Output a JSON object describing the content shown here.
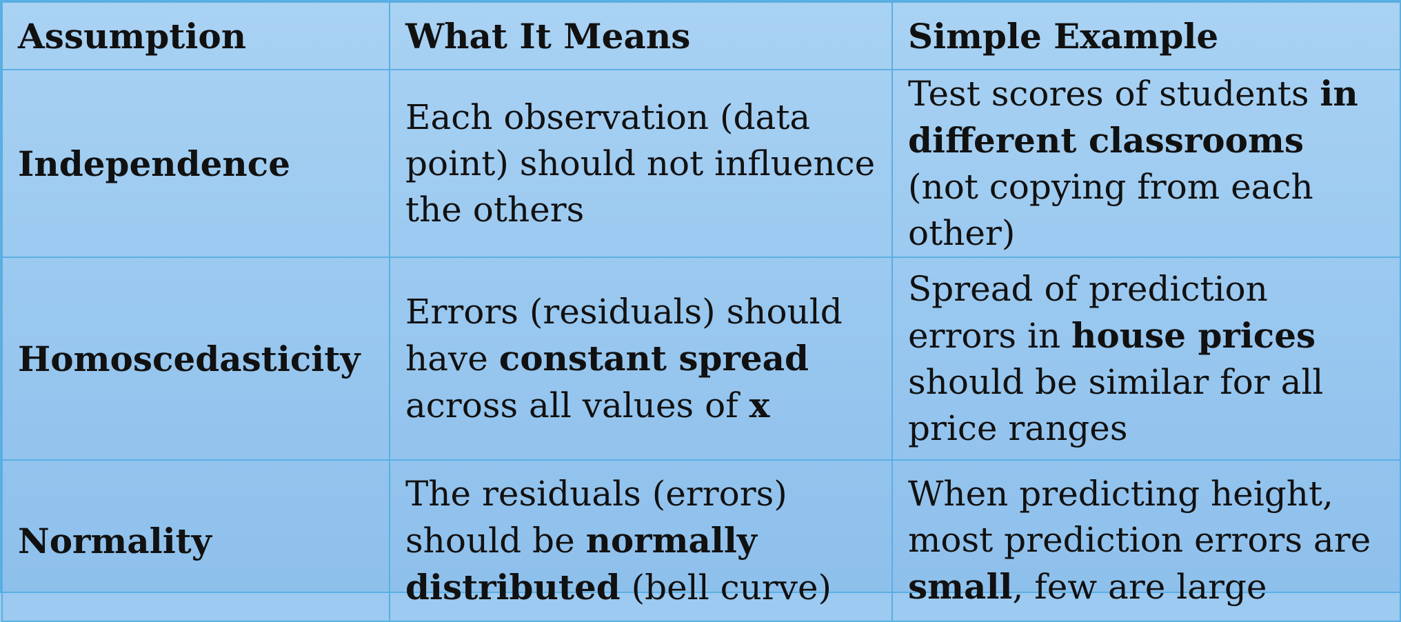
{
  "table": {
    "headers": [
      "Assumption",
      "What It Means",
      "Simple Example"
    ],
    "rows": [
      {
        "assumption": "Independence",
        "meaning": [
          {
            "text": "Each observation (data point) should not influence the others",
            "bold": false
          }
        ],
        "example": [
          {
            "text": "Test scores of students ",
            "bold": false
          },
          {
            "text": "in different classrooms",
            "bold": true
          },
          {
            "text": " (not copying from each other)",
            "bold": false
          }
        ]
      },
      {
        "assumption": "Homoscedasticity",
        "meaning": [
          {
            "text": "Errors (residuals) should have ",
            "bold": false
          },
          {
            "text": "constant spread",
            "bold": true
          },
          {
            "text": " across all values of ",
            "bold": false
          },
          {
            "text": "x",
            "bold": true
          }
        ],
        "example": [
          {
            "text": "Spread of prediction errors in ",
            "bold": false
          },
          {
            "text": "house prices",
            "bold": true
          },
          {
            "text": " should be similar for all price ranges",
            "bold": false
          }
        ]
      },
      {
        "assumption": "Normality",
        "meaning": [
          {
            "text": "The residuals (errors) should be ",
            "bold": false
          },
          {
            "text": "normally distributed",
            "bold": true
          },
          {
            "text": " (bell curve)",
            "bold": false
          }
        ],
        "example": [
          {
            "text": "When predicting height, most prediction errors are ",
            "bold": false
          },
          {
            "text": "small",
            "bold": true
          },
          {
            "text": ", few are large",
            "bold": false
          }
        ]
      }
    ]
  },
  "colors": {
    "background_top": "#a9d2f3",
    "background_bottom": "#8ec0ec",
    "border": "#5aaee2",
    "text": "#111111"
  }
}
